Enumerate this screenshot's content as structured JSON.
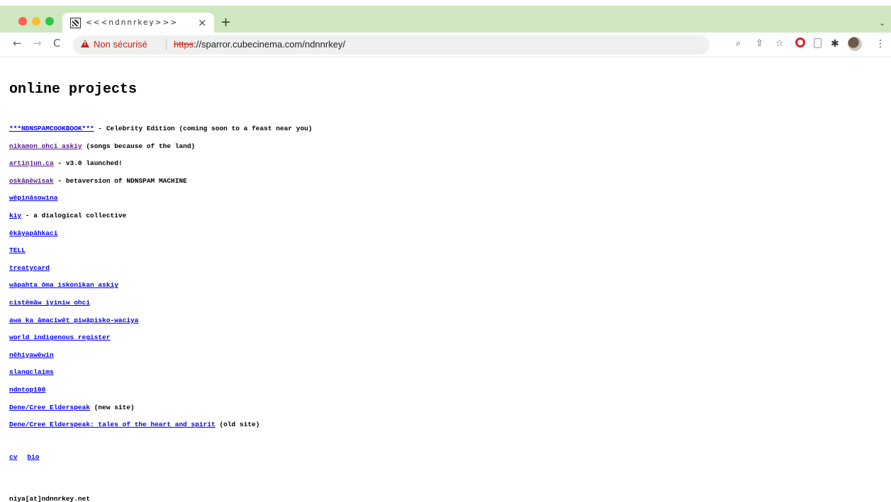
{
  "browser": {
    "tab": {
      "title": "<<<ndnnrkey>>>",
      "close": "×"
    },
    "new_tab": "+",
    "tab_menu": "⌄",
    "nav": {
      "back": "←",
      "forward": "→",
      "reload": "C"
    },
    "address": {
      "security_label": "Non sécurisé",
      "scheme": "https",
      "rest": "://sparror.cubecinema.com/ndnnrkey/"
    },
    "toolbar_icons": {
      "zoom": "⌕",
      "share": "⇧",
      "star": "☆",
      "puzzle": "✱",
      "kebab": "⋮"
    }
  },
  "page": {
    "title": "online projects",
    "projects": [
      {
        "link": "***NDNSPAMCOOKBOOK***",
        "note": " - Celebrity Edition (coming soon to a feast near you)"
      },
      {
        "link": "nikamon ohci askiy",
        "note": " (songs because of the land)"
      },
      {
        "link": "artinjun.ca",
        "note": " - v3.0 launched!"
      },
      {
        "link": "oskâpêwisak",
        "note": " - betaversion of NDNSPAM MACHINE"
      },
      {
        "link": "wêpinâsowina",
        "note": ""
      },
      {
        "link": "kiy",
        "note": " - a dialogical collective"
      },
      {
        "link": "êkâyapâhkaci",
        "note": ""
      },
      {
        "link": "TELL",
        "note": ""
      },
      {
        "link": "treatycard",
        "note": ""
      },
      {
        "link": "wâpahta ôma iskonikan askiy",
        "note": ""
      },
      {
        "link": "cistêmâw iyiniw ohci",
        "note": ""
      },
      {
        "link": "awa ka âmaciwêt piwâpisko-waciya",
        "note": ""
      },
      {
        "link": "world indigenous register",
        "note": ""
      },
      {
        "link": "nêhiyawêwin",
        "note": ""
      },
      {
        "link": "slangclaims",
        "note": ""
      },
      {
        "link": "ndntop100",
        "note": ""
      },
      {
        "link": "Dene/Cree Elderspeak",
        "note": " (new site)"
      },
      {
        "link": "Dene/Cree Elderspeak: tales of the heart and spirit",
        "note": " (old site)"
      }
    ],
    "footer_links": {
      "cv": "cv",
      "bio": "bio"
    },
    "contact": "niya[at]ndnnrkey.net"
  },
  "colors": {
    "tabstrip": "#cfe8c1",
    "link": "#0000ee",
    "visited_link": "#551a8b",
    "warning": "#c5221f"
  }
}
